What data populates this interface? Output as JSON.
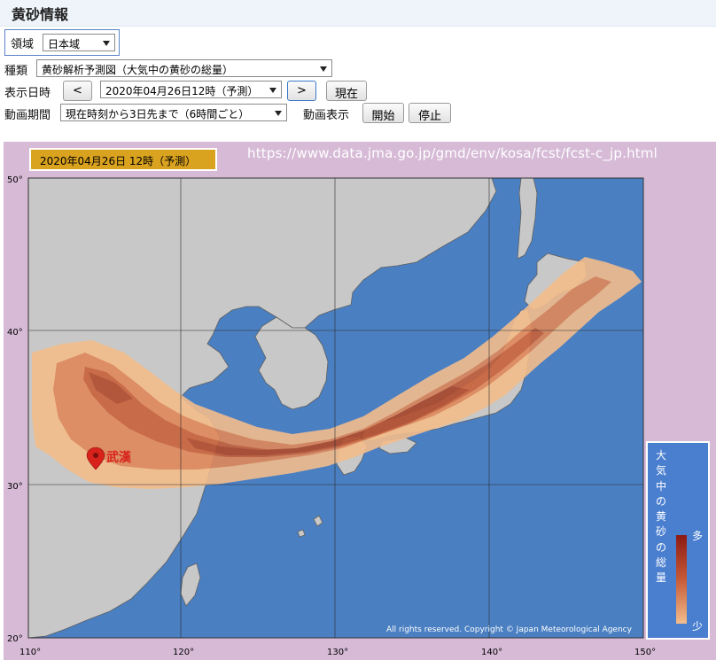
{
  "page": {
    "title": "黄砂情報"
  },
  "controls": {
    "region_label": "領域",
    "region_value": "日本域",
    "type_label": "種類",
    "type_value": "黄砂解析予測図（大気中の黄砂の総量）",
    "date_label": "表示日時",
    "prev_label": "<",
    "date_value": "2020年04月26日12時（予測）",
    "next_label": ">",
    "now_label": "現在",
    "period_label": "動画期間",
    "period_value": "現在時刻から3日先まで（6時間ごと）",
    "animation_label": "動画表示",
    "start_label": "開始",
    "stop_label": "停止"
  },
  "map": {
    "date_badge": "2020年04月26日  12時（予測）",
    "url": "https://www.data.jma.go.jp/gmd/env/kosa/fcst/fcst-c_jp.html",
    "lat_labels": [
      "50°",
      "40°",
      "30°",
      "20°"
    ],
    "lon_labels": [
      "110°",
      "120°",
      "130°",
      "140°",
      "150°"
    ],
    "place_label": "武漢",
    "copyright": "All rights reserved. Copyright © Japan Meteorological Agency",
    "colors": {
      "ocean": "#4a7fc2",
      "land": "#c8c8c8",
      "dust_high": "#8c1a14",
      "dust_low": "#f3bd8c",
      "frame": "#d6bad6"
    },
    "legend": {
      "title": "大気中の黄砂の総量",
      "high": "多",
      "low": "少"
    }
  }
}
